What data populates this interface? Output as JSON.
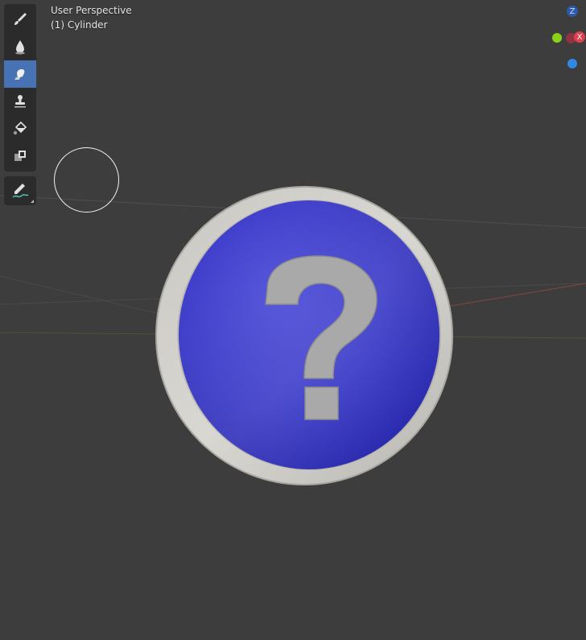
{
  "viewport": {
    "view_name": "User Perspective",
    "object_label": "(1) Cylinder",
    "background_color": "#3d3d3d"
  },
  "toolbar": {
    "tools": [
      {
        "name": "draw",
        "icon": "brush-icon",
        "active": false
      },
      {
        "name": "blur",
        "icon": "droplet-icon",
        "active": false
      },
      {
        "name": "smear",
        "icon": "smear-hand-icon",
        "active": true
      },
      {
        "name": "clone",
        "icon": "stamp-icon",
        "active": false
      },
      {
        "name": "fill",
        "icon": "paint-bucket-icon",
        "active": false
      },
      {
        "name": "mask",
        "icon": "mask-icon",
        "active": false
      }
    ],
    "annotate_tool": {
      "name": "annotate",
      "icon": "annotate-pen-icon"
    }
  },
  "navigation_gizmo": {
    "z_label": "Z",
    "x_label": "X",
    "colors": {
      "x": "#e0404e",
      "y": "#8bd21a",
      "z": "#2f8ae5"
    }
  },
  "scene": {
    "object": "question-mark-coin",
    "coin_face_color": "#3333cc",
    "coin_rim_color": "#cfcdc8",
    "symbol_color": "#aaaaaa"
  }
}
